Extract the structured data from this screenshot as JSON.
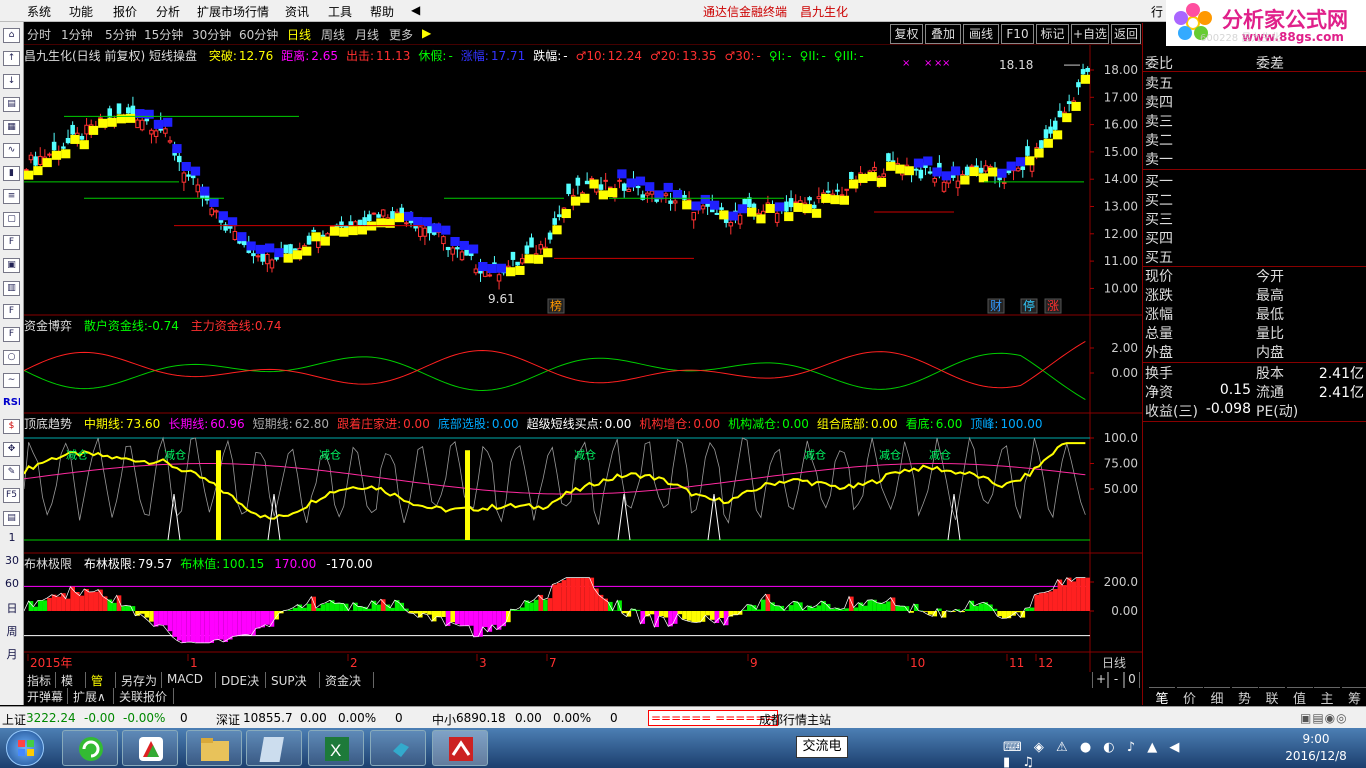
{
  "menu": {
    "items": [
      "系统",
      "功能",
      "报价",
      "分析",
      "扩展市场行情",
      "资讯",
      "工具",
      "帮助"
    ],
    "center_title": "通达信金融终端",
    "stock_title": "昌九生化",
    "right_label": "行"
  },
  "logo": {
    "text": "分析家公式网",
    "url": "www.88gs.com",
    "overlay": "600228 昌九生化"
  },
  "periods": {
    "items": [
      "分时",
      "1分钟",
      "5分钟",
      "15分钟",
      "30分钟",
      "60分钟",
      "日线",
      "周线",
      "月线",
      "更多"
    ],
    "active": "日线"
  },
  "top_buttons": [
    "复权",
    "叠加",
    "画线",
    "F10",
    "标记",
    "+自选",
    "返回"
  ],
  "left_toolbar": {
    "labels": [
      "1",
      "30",
      "60",
      "日",
      "周",
      "月"
    ]
  },
  "kline_panel": {
    "title": "昌九生化(日线 前复权) 短线操盘",
    "items": [
      {
        "label": "突破:",
        "value": "12.76",
        "color": "#ffff00"
      },
      {
        "label": "距离:",
        "value": "2.65",
        "color": "#ff00ff"
      },
      {
        "label": "出击:",
        "value": "11.13",
        "color": "#ff3030"
      },
      {
        "label": "休假:",
        "value": "-",
        "color": "#00ff00"
      },
      {
        "label": "涨幅:",
        "value": "17.71",
        "color": "#3333ff"
      },
      {
        "label": "跌幅:",
        "value": "-",
        "color": "#ffffff"
      },
      {
        "label": "♂10:",
        "value": "12.24",
        "color": "#ff3030"
      },
      {
        "label": "♂20:",
        "value": "13.35",
        "color": "#ff3030"
      },
      {
        "label": "♂30:",
        "value": "-",
        "color": "#ff3030"
      },
      {
        "label": "♀I:",
        "value": "-",
        "color": "#00ff00"
      },
      {
        "label": "♀II:",
        "value": "-",
        "color": "#00ff00"
      },
      {
        "label": "♀III:",
        "value": "-",
        "color": "#00ff00"
      }
    ],
    "y_ticks": [
      "18.00",
      "17.00",
      "16.00",
      "15.00",
      "14.00",
      "13.00",
      "12.00",
      "11.00",
      "10.00"
    ],
    "high_label": "18.18",
    "low_label": "9.61",
    "markers": [
      {
        "text": "榜"
      },
      {
        "text": "财"
      },
      {
        "text": "停"
      },
      {
        "text": "涨"
      }
    ]
  },
  "fund_panel": {
    "title": "资金博弈",
    "retail_label": "散户资金线:",
    "retail_value": "-0.74",
    "main_label": "主力资金线:",
    "main_value": "0.74",
    "y_ticks": [
      "2.00",
      "0.00"
    ]
  },
  "trend_panel": {
    "title": "顶底趋势",
    "items": [
      {
        "label": "中期线:",
        "value": "73.60",
        "color": "#ffff00"
      },
      {
        "label": "长期线:",
        "value": "60.96",
        "color": "#ff00ff"
      },
      {
        "label": "短期线:",
        "value": "62.80",
        "color": "#aaaaaa"
      },
      {
        "label": "跟着庄家进:",
        "value": "0.00",
        "color": "#ff3030"
      },
      {
        "label": "底部选股:",
        "value": "0.00",
        "color": "#00aaff"
      },
      {
        "label": "超级短线买点:",
        "value": "0.00",
        "color": "#ffffff"
      },
      {
        "label": "机构增仓:",
        "value": "0.00",
        "color": "#ff3030"
      },
      {
        "label": "机构减仓:",
        "value": "0.00",
        "color": "#00ff00"
      },
      {
        "label": "组合底部:",
        "value": "0.00",
        "color": "#ffff00"
      },
      {
        "label": "看底:",
        "value": "6.00",
        "color": "#00ff00"
      },
      {
        "label": "顶峰:",
        "value": "100.00",
        "color": "#00aaff"
      }
    ],
    "y_ticks": [
      "100.0",
      "75.00",
      "50.00"
    ],
    "reduce_label": "减仓"
  },
  "boll_panel": {
    "title": "布林极限",
    "items": [
      {
        "label": "布林极限:",
        "value": "79.57",
        "color": "#ffffff"
      },
      {
        "label": "布林值:",
        "value": "100.15",
        "color": "#00ff00"
      },
      {
        "label": "",
        "value": "170.00",
        "color": "#ff00ff"
      },
      {
        "label": "",
        "value": "-170.00",
        "color": "#ffffff"
      }
    ],
    "y_ticks": [
      "200.0",
      "0.00"
    ]
  },
  "x_axis": {
    "labels": [
      "2015年",
      "1",
      "2",
      "3",
      "7",
      "9",
      "10",
      "11",
      "12"
    ],
    "period_label": "日线"
  },
  "bottom_tabs": [
    "指标",
    "模板",
    "管理",
    "另存为",
    "MACD基本",
    "DDE决策",
    "SUP决策",
    "资金决策"
  ],
  "bottom_tabs2": [
    "开弹幕",
    "扩展∧",
    "关联报价"
  ],
  "zoom_buttons": [
    "+",
    "-",
    "0"
  ],
  "right_panel": {
    "weibi": "委比",
    "weicha": "委差",
    "sells": [
      "卖五",
      "卖四",
      "卖三",
      "卖二",
      "卖一"
    ],
    "buys": [
      "买一",
      "买二",
      "买三",
      "买四",
      "买五"
    ],
    "quote_rows": [
      [
        "现价",
        "今开"
      ],
      [
        "涨跌",
        "最高"
      ],
      [
        "涨幅",
        "最低"
      ],
      [
        "总量",
        "量比"
      ],
      [
        "外盘",
        "内盘"
      ]
    ],
    "fin_rows": [
      {
        "l1": "换手",
        "v1": "",
        "l2": "股本",
        "v2": "2.41亿"
      },
      {
        "l1": "净资",
        "v1": "0.15",
        "l2": "流通",
        "v2": "2.41亿"
      },
      {
        "l1": "收益(三)",
        "v1": "-0.098",
        "l2": "PE(动)",
        "v2": ""
      }
    ],
    "tabs": [
      "笔",
      "价",
      "细",
      "势",
      "联",
      "值",
      "主",
      "筹"
    ]
  },
  "status": {
    "sh_label": "上证",
    "sh_value": "3222.24",
    "sh_chg": "-0.00",
    "sh_pct": "-0.00%",
    "sh_vol": "0",
    "sz_label": "深证",
    "sz_value": "10855.7",
    "sz_chg": "0.00",
    "sz_pct": "0.00%",
    "sz_vol": "0",
    "zx_label": "中小",
    "zx_value": "6890.18",
    "zx_chg": "0.00",
    "zx_pct": "0.00%",
    "zx_vol": "0",
    "bars": "====== ======",
    "server": "成都行情主站"
  },
  "taskbar": {
    "ime": "交流电",
    "time": "9:00",
    "date": "2016/12/8"
  }
}
